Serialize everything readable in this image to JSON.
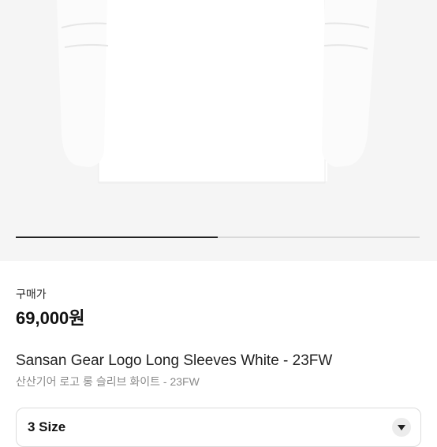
{
  "product": {
    "image_progress_percent": 50
  },
  "price": {
    "label": "구매가",
    "value": "69,000원"
  },
  "title": {
    "en": "Sansan Gear Logo Long Sleeves White - 23FW",
    "ko": "산산기어 로고 롱 슬리브 화이트 - 23FW"
  },
  "size_selector": {
    "selected": "3 Size",
    "icon": "chevron-down-icon"
  }
}
